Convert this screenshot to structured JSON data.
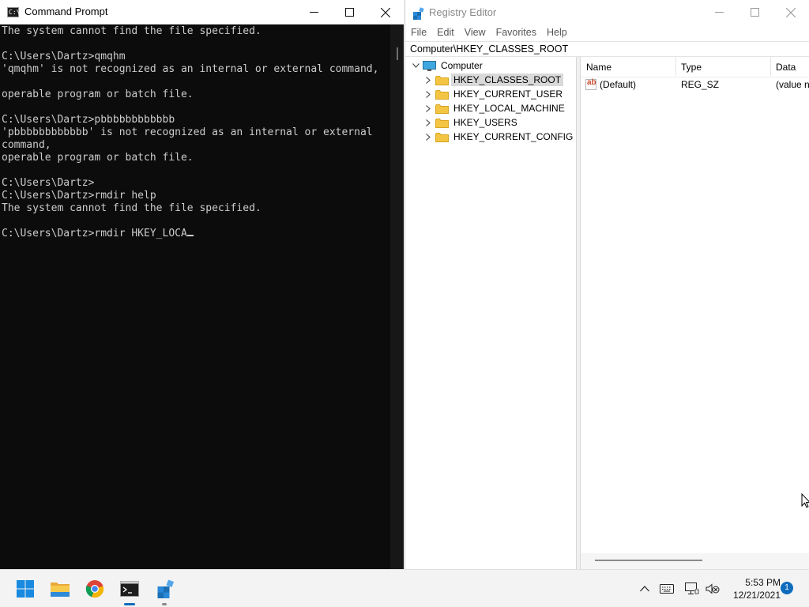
{
  "cmd": {
    "title": "Command Prompt",
    "icon_text": "C:\\",
    "lines": [
      "The system cannot find the file specified.",
      "",
      "C:\\Users\\Dartz>qmqhm",
      "'qmqhm' is not recognized as an internal or external command,",
      "",
      "operable program or batch file.",
      "",
      "C:\\Users\\Dartz>pbbbbbbbbbbbb",
      "'pbbbbbbbbbbbb' is not recognized as an internal or external",
      "command,",
      "operable program or batch file.",
      "",
      "C:\\Users\\Dartz>",
      "C:\\Users\\Dartz>rmdir help",
      "The system cannot find the file specified.",
      "",
      "C:\\Users\\Dartz>rmdir HKEY_LOCA"
    ],
    "controls": [
      "minimize-icon",
      "maximize-icon",
      "close-icon"
    ]
  },
  "registry": {
    "title": "Registry Editor",
    "menu": [
      "File",
      "Edit",
      "View",
      "Favorites",
      "Help"
    ],
    "address": "Computer\\HKEY_CLASSES_ROOT",
    "tree": {
      "root": "Computer",
      "keys": [
        "HKEY_CLASSES_ROOT",
        "HKEY_CURRENT_USER",
        "HKEY_LOCAL_MACHINE",
        "HKEY_USERS",
        "HKEY_CURRENT_CONFIG"
      ],
      "selected": "HKEY_CLASSES_ROOT"
    },
    "columns": [
      "Name",
      "Type",
      "Data"
    ],
    "values": [
      {
        "name": "(Default)",
        "type": "REG_SZ",
        "data": "(value n"
      }
    ]
  },
  "taskbar": {
    "apps": [
      "start-icon",
      "file-explorer-icon",
      "chrome-icon",
      "command-prompt-icon",
      "registry-editor-icon"
    ],
    "time": "5:53 PM",
    "date": "12/21/2021",
    "notifications": "1"
  },
  "colors": {
    "console_bg": "#0c0c0c",
    "console_text": "#cccccc",
    "accent": "#0f6cbd",
    "folder": "#f4c542",
    "selection": "#d9d9d9"
  }
}
